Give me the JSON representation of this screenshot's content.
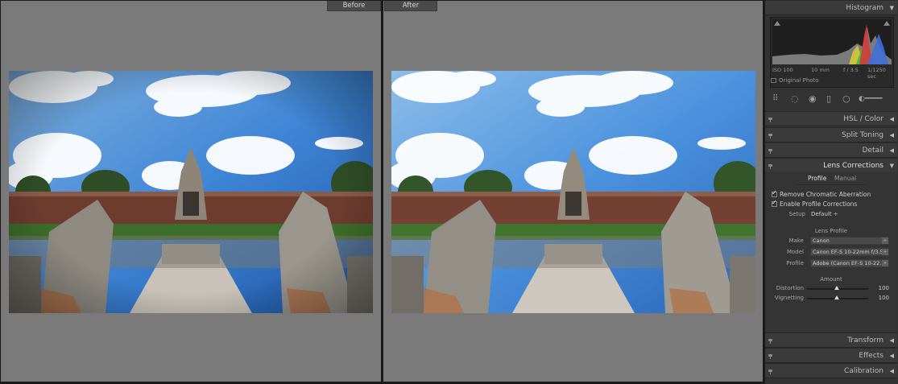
{
  "compare": {
    "before_label": "Before",
    "after_label": "After"
  },
  "panel": {
    "histogram": {
      "title": "Histogram",
      "iso": "ISO 100",
      "focal": "10 mm",
      "aperture": "f / 3.5",
      "shutter": "1/1250 sec",
      "original_photo": "Original Photo"
    },
    "sections": {
      "hsl": {
        "title": "HSL / Color"
      },
      "split_toning": {
        "title": "Split Toning"
      },
      "detail": {
        "title": "Detail"
      },
      "lens": {
        "title": "Lens Corrections"
      },
      "transform": {
        "title": "Transform"
      },
      "effects": {
        "title": "Effects"
      },
      "calibration": {
        "title": "Calibration"
      }
    },
    "lens": {
      "tab_profile": "Profile",
      "tab_manual": "Manual",
      "remove_ca": "Remove Chromatic Aberration",
      "enable_profile": "Enable Profile Corrections",
      "setup_label": "Setup",
      "setup_value": "Default ÷",
      "lens_profile_title": "Lens Profile",
      "make_label": "Make",
      "make_value": "Canon",
      "model_label": "Model",
      "model_value": "Canon EF-S 10-22mm f/3.5...",
      "profile_label": "Profile",
      "profile_value": "Adobe (Canon EF-S 10-22...",
      "amount_title": "Amount",
      "distortion_label": "Distortion",
      "distortion_value": "100",
      "vignetting_label": "Vignetting",
      "vignetting_value": "100"
    }
  }
}
